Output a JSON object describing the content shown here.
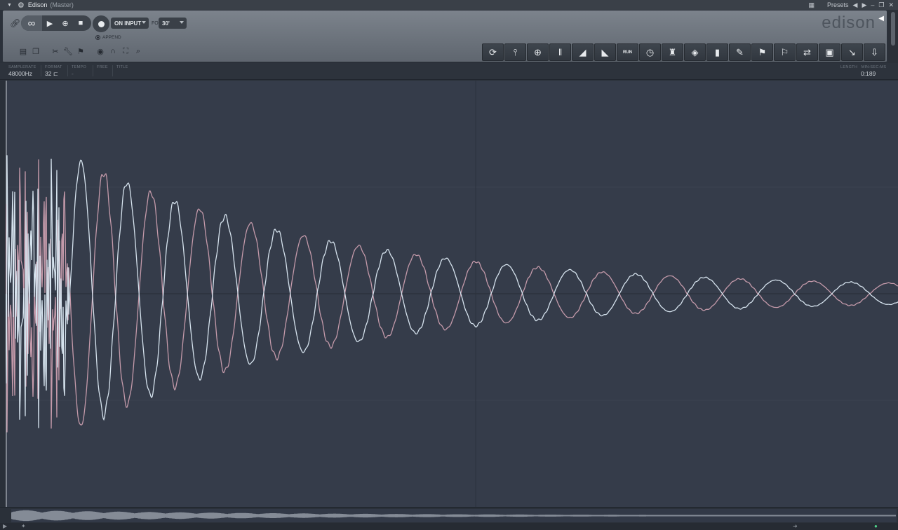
{
  "window": {
    "title": "Edison",
    "subtitle": "(Master)",
    "presets_label": "Presets"
  },
  "toolbar": {
    "record_mode": "ON INPUT",
    "for_label": "FOR",
    "duration": "30'",
    "append_label": "APPEND",
    "logo": "edison"
  },
  "tools": [
    {
      "name": "normalize-icon",
      "glyph": "⟳"
    },
    {
      "name": "amplify-icon",
      "glyph": "⫯"
    },
    {
      "name": "center-icon",
      "glyph": "⊕"
    },
    {
      "name": "declick-icon",
      "glyph": "ǁ"
    },
    {
      "name": "fade-in-icon",
      "glyph": "◢"
    },
    {
      "name": "fade-out-icon",
      "glyph": "◣"
    },
    {
      "name": "run-icon",
      "glyph": "RUN"
    },
    {
      "name": "tempo-icon",
      "glyph": "◷"
    },
    {
      "name": "reverb-icon",
      "glyph": "♜"
    },
    {
      "name": "blur-icon",
      "glyph": "◈"
    },
    {
      "name": "spectrum-icon",
      "glyph": "▮"
    },
    {
      "name": "pencil-icon",
      "glyph": "✎"
    },
    {
      "name": "add-marker-icon",
      "glyph": "⚑"
    },
    {
      "name": "marker-tool-icon",
      "glyph": "⚐"
    },
    {
      "name": "swap-icon",
      "glyph": "⇄"
    },
    {
      "name": "save-icon",
      "glyph": "▣"
    },
    {
      "name": "drag-icon",
      "glyph": "↘"
    },
    {
      "name": "send-to-playlist-icon",
      "glyph": "⇩"
    }
  ],
  "info": {
    "samplerate_label": "SAMPLERATE",
    "samplerate": "48000Hz",
    "format_label": "FORMAT",
    "format": "32",
    "tempo_label": "TEMPO",
    "tempo": "-",
    "free_label": "FREE",
    "title_label": "TITLE",
    "length_label": "LENGTH",
    "length_unit_label": "MIN:SEC:MS",
    "length": "0:189"
  },
  "colors": {
    "wave_light": "#d6e3ee",
    "wave_pink": "#c49aaa",
    "background": "#353c4a"
  }
}
